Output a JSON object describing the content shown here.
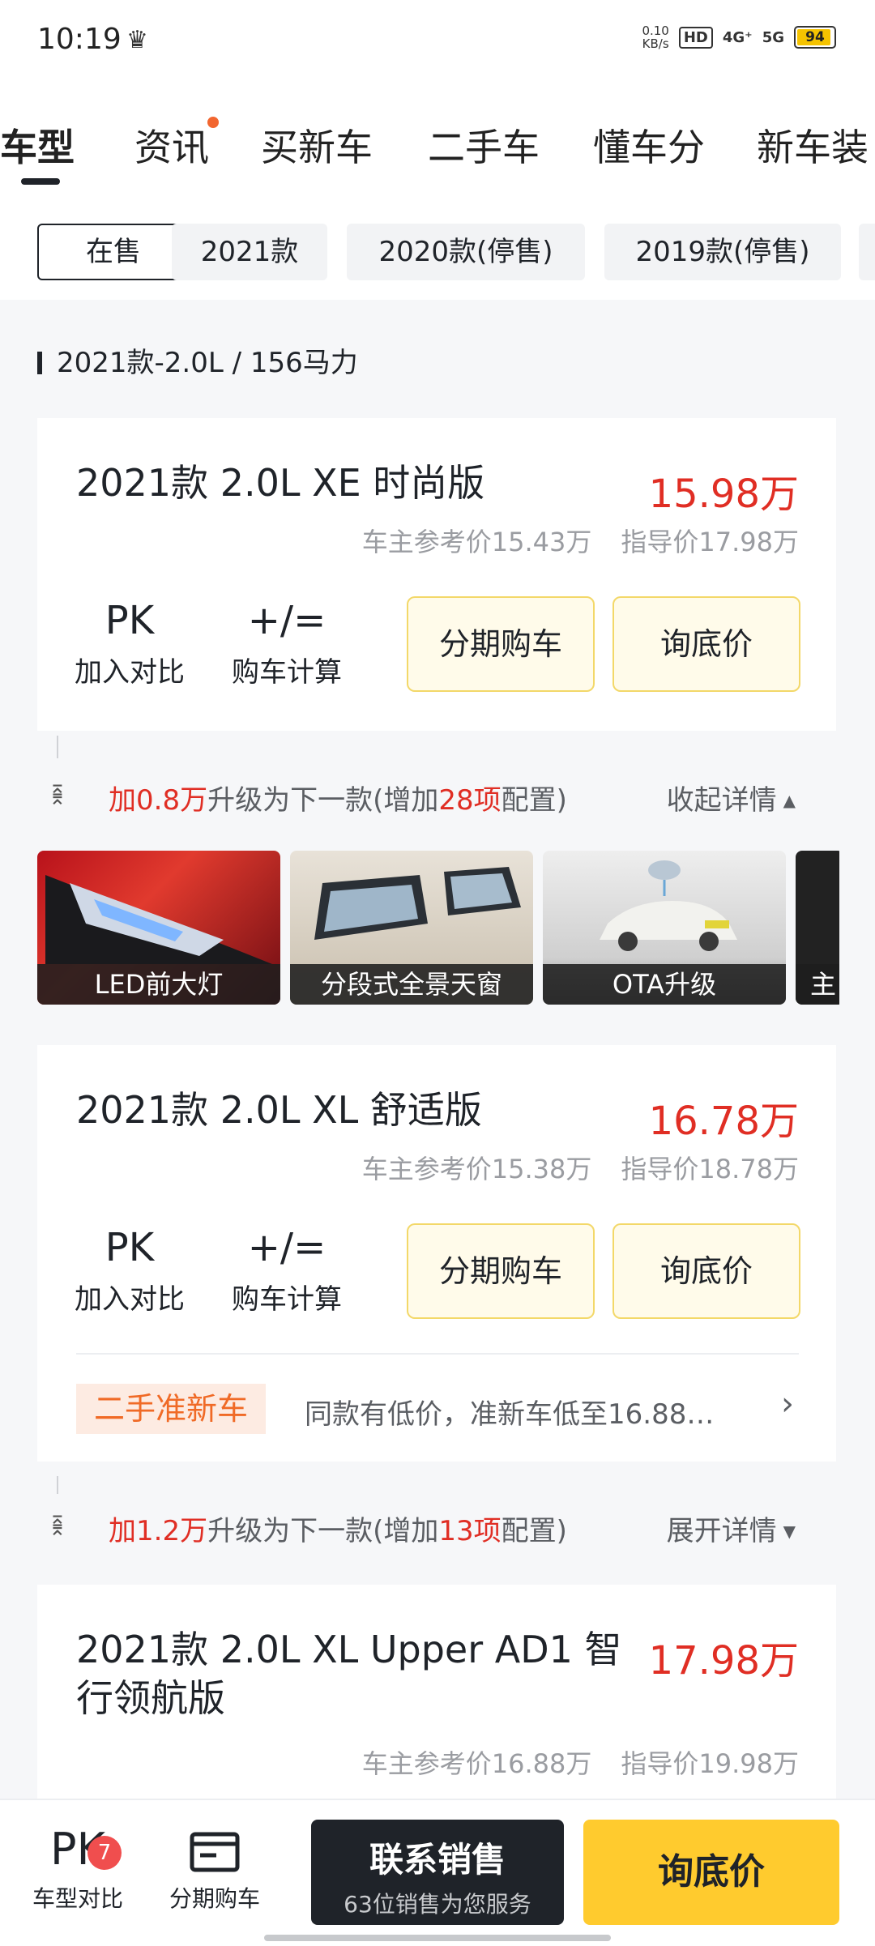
{
  "status_bar": {
    "time": "10:19",
    "net_speed_value": "0.10",
    "net_speed_unit": "KB/s",
    "hd": "HD",
    "sig1": "4G⁺",
    "sig2": "5G",
    "battery": "94"
  },
  "nav_tabs": [
    "车型",
    "资讯",
    "买新车",
    "二手车",
    "懂车分",
    "新车装"
  ],
  "filter_chips": [
    "在售",
    "2021款",
    "2020款(停售)",
    "2019款(停售)"
  ],
  "section_title": "2021款-2.0L / 156马力",
  "cars": [
    {
      "name": "2021款 2.0L XE 时尚版",
      "price": "15.98万",
      "owner_price": "车主参考价15.43万",
      "guide_price": "指导价17.98万"
    },
    {
      "name": "2021款 2.0L XL 舒适版",
      "price": "16.78万",
      "owner_price": "车主参考价15.38万",
      "guide_price": "指导价18.78万"
    },
    {
      "name": "2021款 2.0L XL Upper AD1 智行领航版",
      "price": "17.98万",
      "owner_price": "车主参考价16.88万",
      "guide_price": "指导价19.98万"
    }
  ],
  "actions": {
    "pk_icon": "PK",
    "pk_label": "加入对比",
    "calc_icon": "+∕=",
    "calc_label": "购车计算",
    "installment": "分期购车",
    "inquiry": "询底价"
  },
  "upgrades": [
    {
      "prefix": "加0.8万",
      "middle": "升级为下一款(增加",
      "count": "28项",
      "suffix": "配置)",
      "toggle": "收起详情"
    },
    {
      "prefix": "加1.2万",
      "middle": "升级为下一款(增加",
      "count": "13项",
      "suffix": "配置)",
      "toggle": "展开详情"
    }
  ],
  "features": [
    "LED前大灯",
    "分段式全景天窗",
    "OTA升级",
    "主"
  ],
  "used_car": {
    "tag": "二手准新车",
    "text": "同款有低价，准新车低至16.88…"
  },
  "bottom_bar": {
    "compare_icon": "PK",
    "compare_badge": "7",
    "compare_label": "车型对比",
    "installment_label": "分期购车",
    "contact_title": "联系销售",
    "contact_sub": "63位销售为您服务",
    "inquiry": "询底价"
  },
  "colors": {
    "price_red": "#e02e24",
    "accent_yellow": "#ffcb2e",
    "dark": "#1f2329",
    "used_orange": "#f06a26"
  }
}
